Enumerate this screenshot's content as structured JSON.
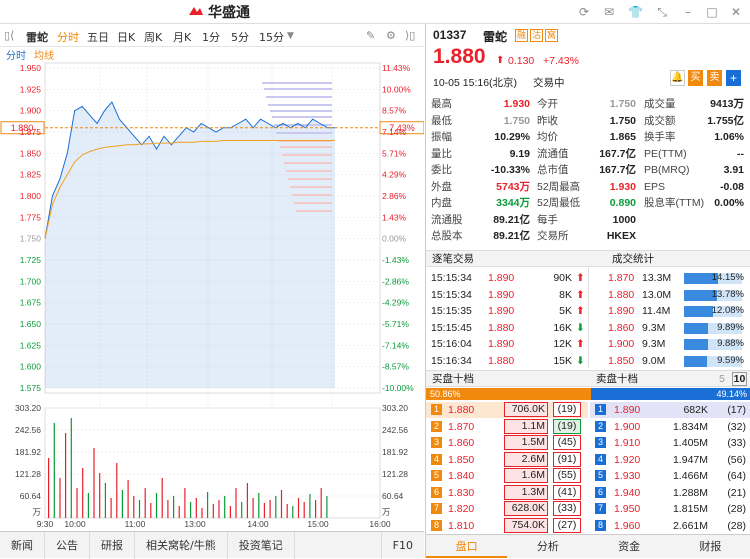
{
  "app": {
    "name": "华盛通"
  },
  "toolbar": {
    "stock_name": "雷蛇",
    "tabs": [
      "分时",
      "五日",
      "日K",
      "周K",
      "月K",
      "1分",
      "5分",
      "15分"
    ],
    "sub": [
      "分时",
      "均线"
    ]
  },
  "chart": {
    "y_price": [
      "1.950",
      "1.925",
      "1.900",
      "1.875",
      "1.850",
      "1.825",
      "1.800",
      "1.775",
      "1.750",
      "1.725",
      "1.700",
      "1.675",
      "1.650",
      "1.625",
      "1.600",
      "1.575"
    ],
    "y_pct": [
      "11.43%",
      "10.00%",
      "8.57%",
      "7.14%",
      "5.71%",
      "4.29%",
      "2.86%",
      "1.43%",
      "0.00%",
      "-1.43%",
      "-2.86%",
      "-4.29%",
      "-5.71%",
      "-7.14%",
      "-8.57%",
      "-10.00%"
    ],
    "current_price": "1.880",
    "current_pct": "7.43%",
    "vol_labels": [
      "303.20",
      "242.56",
      "181.92",
      "121.28",
      "60.64",
      "万"
    ],
    "x_labels": [
      "9:30",
      "10:00",
      "11:00",
      "13:00",
      "14:00",
      "15:00",
      "16:00"
    ]
  },
  "chart_data": {
    "type": "line",
    "price_series": [
      1.75,
      1.8,
      1.82,
      1.85,
      1.9,
      1.905,
      1.895,
      1.885,
      1.9,
      1.91,
      1.89,
      1.88,
      1.87,
      1.86,
      1.87,
      1.855,
      1.87,
      1.86,
      1.87,
      1.88,
      1.875,
      1.885,
      1.88,
      1.875,
      1.88,
      1.88,
      1.885,
      1.89,
      1.88,
      1.89,
      1.885,
      1.88,
      1.885,
      1.88,
      1.885,
      1.88,
      1.89,
      1.885,
      1.88,
      1.88
    ],
    "avg_series": [
      1.75,
      1.79,
      1.81,
      1.825,
      1.84,
      1.848,
      1.852,
      1.855,
      1.857,
      1.858,
      1.859,
      1.86,
      1.86,
      1.861,
      1.861,
      1.862,
      1.862,
      1.862,
      1.863,
      1.863,
      1.863,
      1.864,
      1.864,
      1.864,
      1.865,
      1.865,
      1.865,
      1.865,
      1.865,
      1.865,
      1.865,
      1.865,
      1.865,
      1.865,
      1.865,
      1.865,
      1.865,
      1.865,
      1.865,
      1.865
    ],
    "price_range": [
      1.575,
      1.95
    ]
  },
  "quote": {
    "code": "01337",
    "name": "雷蛇",
    "tags": [
      "融",
      "沽",
      "窝"
    ],
    "price": "1.880",
    "change": "0.130",
    "change_pct": "+7.43%",
    "time": "10-05  15:16(北京)",
    "status": "交易中",
    "actions": [
      "买",
      "卖",
      "+"
    ],
    "rows": [
      [
        "最高",
        "1.930",
        "red",
        "今开",
        "1.750",
        "gray",
        "成交量",
        "9413万",
        "black"
      ],
      [
        "最低",
        "1.750",
        "gray",
        "昨收",
        "1.750",
        "black",
        "成交额",
        "1.755亿",
        "black"
      ],
      [
        "振幅",
        "10.29%",
        "black",
        "均价",
        "1.865",
        "black",
        "换手率",
        "1.06%",
        "black"
      ],
      [
        "量比",
        "9.19",
        "black",
        "流通值",
        "167.7亿",
        "black",
        "PE(TTM)",
        "--",
        "black"
      ],
      [
        "委比",
        "-10.33%",
        "black",
        "总市值",
        "167.7亿",
        "black",
        "PB(MRQ)",
        "3.91",
        "black"
      ],
      [
        "外盘",
        "5743万",
        "red",
        "52周最高",
        "1.930",
        "red",
        "EPS",
        "-0.08",
        "black"
      ],
      [
        "内盘",
        "3344万",
        "green",
        "52周最低",
        "0.890",
        "green",
        "股息率(TTM)",
        "0.00%",
        "black"
      ],
      [
        "流通股",
        "89.21亿",
        "black",
        "每手",
        "1000",
        "black",
        "",
        "",
        ""
      ],
      [
        "总股本",
        "89.21亿",
        "black",
        "交易所",
        "HKEX",
        "black",
        "",
        "",
        ""
      ]
    ]
  },
  "trades": {
    "title_left": "逐笔交易",
    "title_right": "成交统计",
    "rows": [
      [
        "15:15:34",
        "1.890",
        "90K",
        "up"
      ],
      [
        "15:15:34",
        "1.890",
        "8K",
        "up"
      ],
      [
        "15:15:35",
        "1.890",
        "5K",
        "up"
      ],
      [
        "15:15:45",
        "1.880",
        "16K",
        "down"
      ],
      [
        "15:16:04",
        "1.890",
        "12K",
        "up"
      ],
      [
        "15:16:34",
        "1.880",
        "15K",
        "down"
      ]
    ],
    "stats": [
      [
        "1.870",
        "13.3M",
        "14.15%",
        0.75
      ],
      [
        "1.880",
        "13.0M",
        "13.78%",
        0.73
      ],
      [
        "1.890",
        "11.4M",
        "12.08%",
        0.64
      ],
      [
        "1.860",
        "9.3M",
        "9.89%",
        0.52
      ],
      [
        "1.900",
        "9.3M",
        "9.88%",
        0.52
      ],
      [
        "1.850",
        "9.0M",
        "9.59%",
        0.51
      ]
    ]
  },
  "book": {
    "bid_title": "买盘十档",
    "ask_title": "卖盘十档",
    "bid_pct": "50.86%",
    "ask_pct": "49.14%",
    "depth_opts": [
      "5",
      "10"
    ],
    "bid_share": 0.5086,
    "bids": [
      [
        "1",
        "1.880",
        "706.0K",
        "(19)"
      ],
      [
        "2",
        "1.870",
        "1.1M",
        "(19)"
      ],
      [
        "3",
        "1.860",
        "1.5M",
        "(45)"
      ],
      [
        "4",
        "1.850",
        "2.6M",
        "(91)"
      ],
      [
        "5",
        "1.840",
        "1.6M",
        "(55)"
      ],
      [
        "6",
        "1.830",
        "1.3M",
        "(41)"
      ],
      [
        "7",
        "1.820",
        "628.0K",
        "(33)"
      ],
      [
        "8",
        "1.810",
        "754.0K",
        "(27)"
      ]
    ],
    "asks": [
      [
        "1",
        "1.890",
        "682K",
        "(17)"
      ],
      [
        "2",
        "1.900",
        "1.834M",
        "(32)"
      ],
      [
        "3",
        "1.910",
        "1.405M",
        "(33)"
      ],
      [
        "4",
        "1.920",
        "1.947M",
        "(56)"
      ],
      [
        "5",
        "1.930",
        "1.466M",
        "(64)"
      ],
      [
        "6",
        "1.940",
        "1.288M",
        "(21)"
      ],
      [
        "7",
        "1.950",
        "1.815M",
        "(28)"
      ],
      [
        "8",
        "1.960",
        "2.661M",
        "(28)"
      ]
    ]
  },
  "bottom_left_tabs": [
    "新闻",
    "公告",
    "研报",
    "相关窝轮/牛熊",
    "投资笔记",
    "F10"
  ],
  "bottom_right_tabs": [
    "盘口",
    "分析",
    "资金",
    "财报"
  ],
  "colors": {
    "red": "#e8212b",
    "green": "#0a9a3a",
    "accent": "#f08a0e",
    "blue": "#1a6fd6"
  }
}
